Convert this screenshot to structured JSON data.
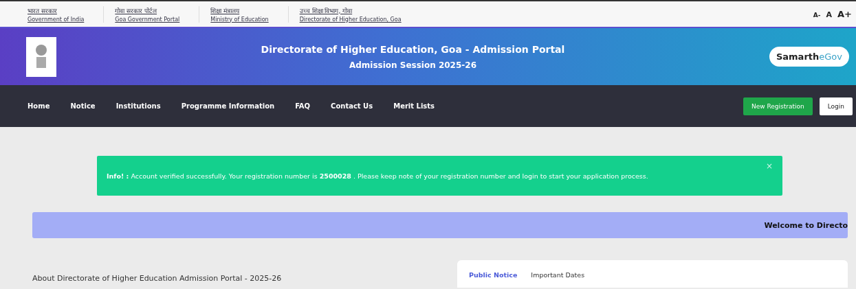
{
  "top_links": [
    {
      "hindi": "भारत सरकार",
      "english": "Government of India"
    },
    {
      "hindi": "गोवा सरकार पोर्टल",
      "english": "Goa Government Portal"
    },
    {
      "hindi": "शिक्षा मंत्रालय",
      "english": "Ministry of Education"
    },
    {
      "hindi": "उच्च शिक्षा विभाग, गोवा",
      "english": "Directorate of Higher Education, Goa"
    }
  ],
  "font_size_controls": [
    "A-",
    "A",
    "A+"
  ],
  "header": {
    "title": "Directorate of Higher Education, Goa - Admission Portal",
    "subtitle": "Admission Session 2025-26",
    "brand": "Samarth",
    "brand_suffix": "eGov"
  },
  "nav": {
    "items": [
      "Home",
      "Notice",
      "Institutions",
      "Programme Information",
      "FAQ",
      "Contact Us",
      "Merit Lists"
    ],
    "buttons": [
      {
        "label": "New Registration",
        "kind": "primary"
      },
      {
        "label": "Login",
        "kind": "plain"
      }
    ]
  },
  "alert": {
    "text": "**Info! :** Account verified successfully. Your registration number is **2500028** . Please keep note of your registration number and login to start your application process.",
    "close": "×"
  },
  "marquee": "Welcome to Directo",
  "about_title": "About Directorate of Higher Education Admission Portal - 2025-26",
  "notice_tabs": [
    {
      "label": "Public Notice",
      "selected": true
    },
    {
      "label": "Important Dates",
      "selected": false
    }
  ]
}
